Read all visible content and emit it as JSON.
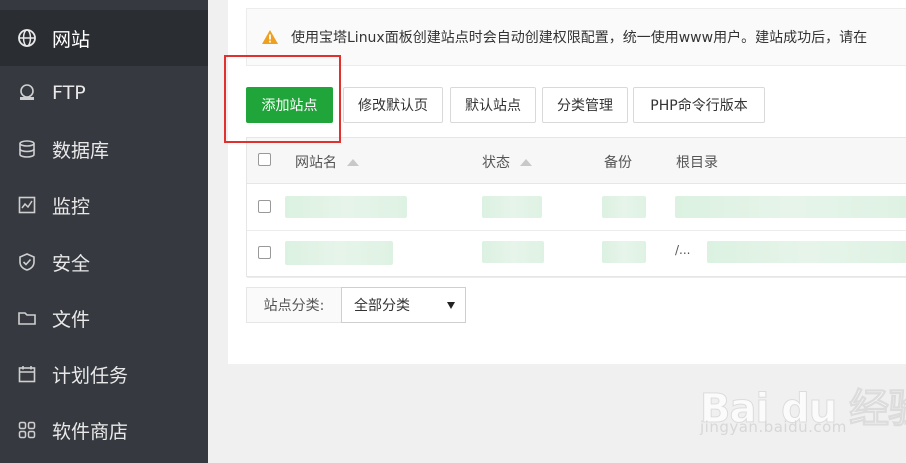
{
  "sidebar": {
    "items": [
      {
        "label": "网站",
        "icon": "globe-icon",
        "active": true
      },
      {
        "label": "FTP",
        "icon": "ftp-icon"
      },
      {
        "label": "数据库",
        "icon": "database-icon"
      },
      {
        "label": "监控",
        "icon": "monitor-icon"
      },
      {
        "label": "安全",
        "icon": "shield-icon"
      },
      {
        "label": "文件",
        "icon": "folder-icon"
      },
      {
        "label": "计划任务",
        "icon": "calendar-icon"
      },
      {
        "label": "软件商店",
        "icon": "grid-icon"
      }
    ]
  },
  "notice": {
    "icon": "warning-icon",
    "text": "使用宝塔Linux面板创建站点时会自动创建权限配置，统一使用www用户。建站成功后，请在"
  },
  "toolbar": {
    "add_site": "添加站点",
    "edit_default_page": "修改默认页",
    "default_site": "默认站点",
    "category_manage": "分类管理",
    "php_cli_version": "PHP命令行版本"
  },
  "table": {
    "columns": {
      "name": "网站名",
      "status": "状态",
      "backup": "备份",
      "root": "根目录"
    },
    "row_ellipsis": "/..."
  },
  "filter": {
    "label": "站点分类:",
    "selected": "全部分类"
  },
  "watermark": {
    "logo": "Bai du 经验",
    "url": "jingyan.baidu.com"
  },
  "colors": {
    "sidebar_bg": "#363a40",
    "sidebar_active": "#2a2d32",
    "primary_green": "#20a53a",
    "highlight_red": "#e0312e",
    "warning_orange": "#f0a020"
  }
}
